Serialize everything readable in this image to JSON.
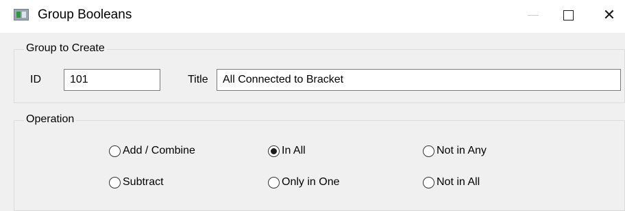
{
  "window": {
    "title": "Group Booleans",
    "close_glyph": "✕"
  },
  "group_to_create": {
    "legend": "Group to Create",
    "id_label": "ID",
    "id_value": "101",
    "title_label": "Title",
    "title_value": "All Connected to Bracket"
  },
  "operation": {
    "legend": "Operation",
    "options": [
      {
        "label": "Add / Combine",
        "checked": false
      },
      {
        "label": "In All",
        "checked": true
      },
      {
        "label": "Not in Any",
        "checked": false
      },
      {
        "label": "Subtract",
        "checked": false
      },
      {
        "label": "Only in One",
        "checked": false
      },
      {
        "label": "Not in All",
        "checked": false
      }
    ]
  }
}
